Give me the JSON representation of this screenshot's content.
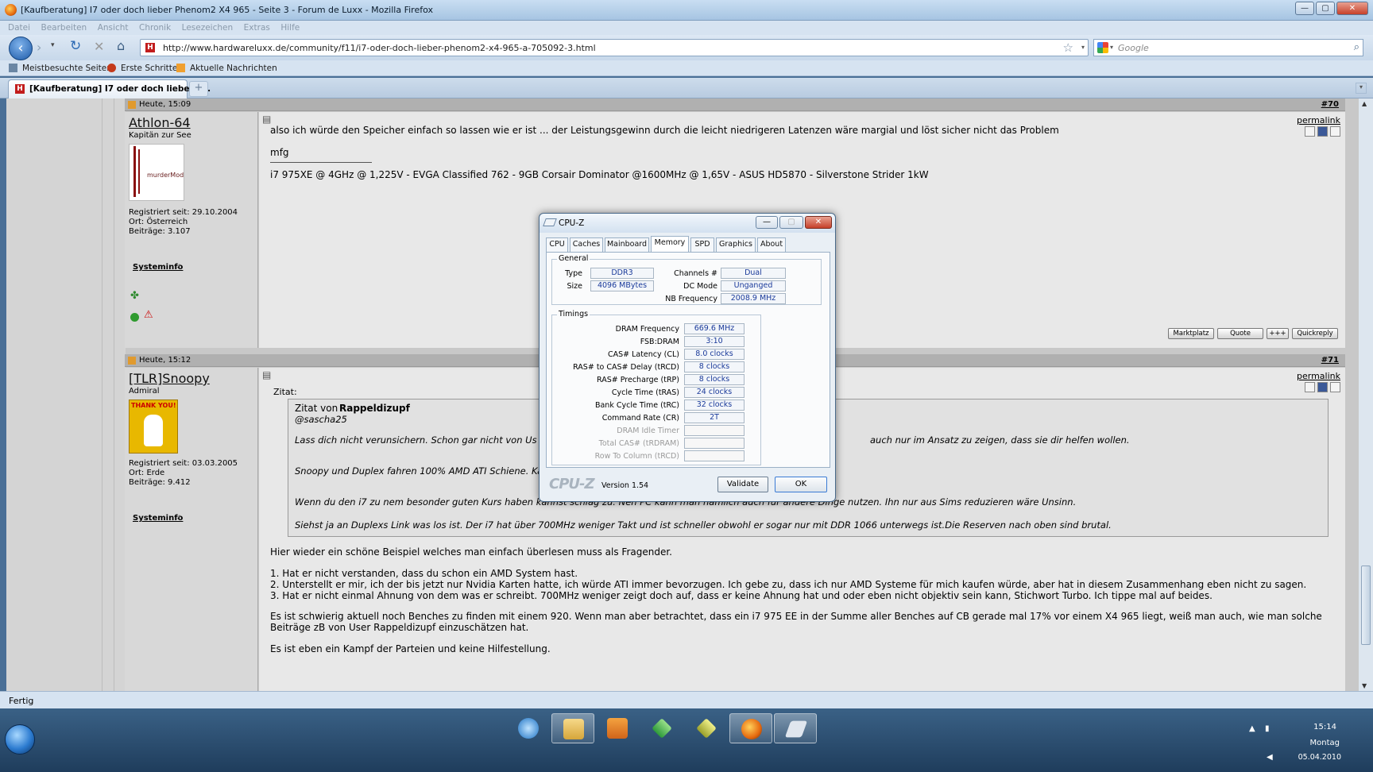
{
  "window": {
    "title": "[Kaufberatung] I7 oder doch lieber Phenom2 X4 965 - Seite 3 - Forum de Luxx - Mozilla Firefox",
    "min": "—",
    "max": "▢",
    "close": "✕"
  },
  "menu": [
    "Datei",
    "Bearbeiten",
    "Ansicht",
    "Chronik",
    "Lesezeichen",
    "Extras",
    "Hilfe"
  ],
  "nav": {
    "url": "http://www.hardwareluxx.de/community/f11/i7-oder-doch-lieber-phenom2-x4-965-a-705092-3.html",
    "search_placeholder": "Google",
    "site_icon": "H"
  },
  "bookmarks": [
    "Meistbesuchte Seiten",
    "Erste Schritte",
    "Aktuelle Nachrichten"
  ],
  "tab": {
    "label": "[Kaufberatung] I7 oder doch lieber P...",
    "new": "+"
  },
  "post1": {
    "date": "Heute, 15:09",
    "num": "#70",
    "user": "Athlon-64",
    "rank": "Kapitän zur See",
    "avatar_text": "murderMod",
    "info": [
      "Registriert seit: 29.10.2004",
      "Ort: Österreich",
      "Beiträge: 3.107"
    ],
    "sysinfo": "Systeminfo",
    "permalink": "permalink",
    "text": "also ich würde den Speicher einfach so lassen wie er ist ... der Leistungsgewinn durch die leicht niedrigeren Latenzen wäre margial und löst sicher nicht das Problem",
    "mfg": "mfg",
    "sig": "i7 975XE @ 4GHz @ 1,225V - EVGA Classified 762 - 9GB Corsair Dominator @1600MHz @ 1,65V - ASUS HD5870 - Silverstone Strider 1kW",
    "buttons": [
      "Marktplatz",
      "Quote",
      "+++",
      "Quickreply"
    ]
  },
  "post2": {
    "date": "Heute, 15:12",
    "num": "#71",
    "user": "[TLR]Snoopy",
    "rank": "Admiral",
    "avatar_text": "THANK YOU!",
    "info": [
      "Registriert seit: 03.03.2005",
      "Ort: Erde",
      "Beiträge: 9.412"
    ],
    "sysinfo": "Systeminfo",
    "permalink": "permalink",
    "zitat": "Zitat:",
    "zitat_von": "Zitat von",
    "zitat_author": "Rappeldizupf",
    "quote_lines": [
      "@sascha25",
      "Lass dich nicht verunsichern. Schon gar nicht von Us",
      "auch nur im Ansatz zu zeigen, dass sie dir helfen wollen.",
      "Snoopy und Duplex fahren 100% AMD ATI Schiene. Ka",
      "Wenn du den i7 zu nem besonder guten Kurs haben kannst schlag zu. Nen PC kann man nämlich auch für andere Dinge nutzen. Ihn nur aus Sims reduzieren wäre Unsinn.",
      "Siehst ja an Duplexs Link was los ist. Der i7 hat über 700MHz weniger Takt und ist schneller obwohl er sogar nur mit DDR 1066 unterwegs ist.Die Reserven nach oben sind brutal."
    ],
    "body": [
      "Hier wieder ein schöne Beispiel welches man einfach überlesen muss als Fragender.",
      "1. Hat er nicht verstanden, dass du schon ein AMD System hast.",
      "2. Unterstellt er mir, ich der bis jetzt nur Nvidia Karten hatte, ich würde ATI immer bevorzugen. Ich gebe zu, dass ich nur AMD Systeme für mich kaufen würde, aber hat in diesem Zusammenhang eben nicht zu sagen.",
      "3. Hat er nicht einmal Ahnung von dem was er schreibt. 700MHz weniger zeigt doch auf, dass er keine Ahnung hat und oder eben nicht objektiv sein kann, Stichwort Turbo. Ich tippe mal auf beides.",
      "Es ist schwierig aktuell noch Benches zu finden mit einem 920. Wenn man aber betrachtet, dass ein i7 975 EE in der Summe aller Benches auf CB gerade mal 17% vor einem X4 965 liegt, weiß man auch, wie man solche",
      "Beiträge zB von User Rappeldizupf einzuschätzen hat.",
      "Es ist eben ein Kampf der Parteien und keine Hilfestellung."
    ]
  },
  "cpuz": {
    "title": "CPU-Z",
    "tabs": [
      "CPU",
      "Caches",
      "Mainboard",
      "Memory",
      "SPD",
      "Graphics",
      "About"
    ],
    "general": "General",
    "type_l": "Type",
    "type_v": "DDR3",
    "size_l": "Size",
    "size_v": "4096 MBytes",
    "ch_l": "Channels #",
    "ch_v": "Dual",
    "dc_l": "DC Mode",
    "dc_v": "Unganged",
    "nb_l": "NB Frequency",
    "nb_v": "2008.9 MHz",
    "timings": "Timings",
    "rows": [
      [
        "DRAM Frequency",
        "669.6 MHz"
      ],
      [
        "FSB:DRAM",
        "3:10"
      ],
      [
        "CAS# Latency (CL)",
        "8.0 clocks"
      ],
      [
        "RAS# to CAS# Delay (tRCD)",
        "8 clocks"
      ],
      [
        "RAS# Precharge (tRP)",
        "8 clocks"
      ],
      [
        "Cycle Time (tRAS)",
        "24 clocks"
      ],
      [
        "Bank Cycle Time (tRC)",
        "32 clocks"
      ],
      [
        "Command Rate (CR)",
        "2T"
      ],
      [
        "DRAM Idle Timer",
        ""
      ],
      [
        "Total CAS# (tRDRAM)",
        ""
      ],
      [
        "Row To Column (tRCD)",
        ""
      ]
    ],
    "logo": "CPU-Z",
    "version": "Version 1.54",
    "validate": "Validate",
    "ok": "OK"
  },
  "status": "Fertig",
  "tray": {
    "time": "15:14",
    "day": "Montag",
    "date": "05.04.2010"
  }
}
